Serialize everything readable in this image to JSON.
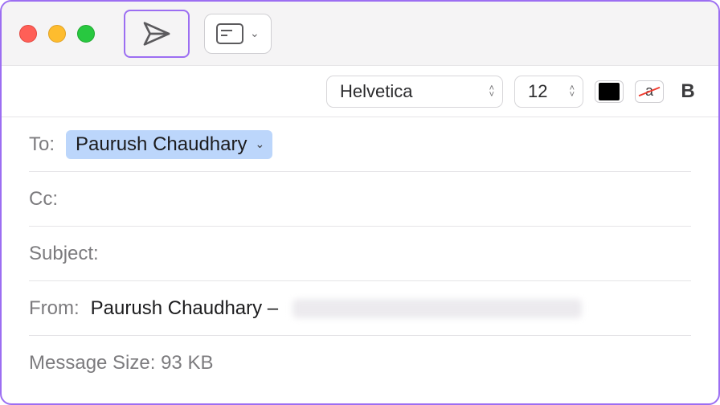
{
  "format": {
    "font": "Helvetica",
    "size": "12",
    "bold_label": "B",
    "highlight_label": "a"
  },
  "fields": {
    "to_label": "To:",
    "to_recipient": "Paurush Chaudhary",
    "cc_label": "Cc:",
    "subject_label": "Subject:",
    "from_label": "From:",
    "from_name": "Paurush Chaudhary –",
    "size_label": "Message Size: 93 KB"
  }
}
